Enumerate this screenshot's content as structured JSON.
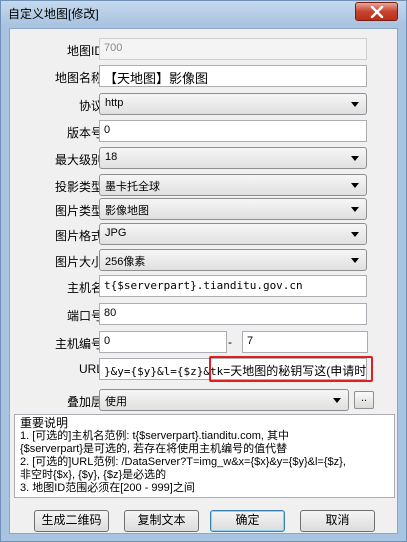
{
  "window": {
    "title": "自定义地图[修改]"
  },
  "form": {
    "map_id": {
      "label": "地图ID",
      "value": "700"
    },
    "map_name": {
      "label": "地图名称",
      "value": "【天地图】影像图"
    },
    "protocol": {
      "label": "协议",
      "value": "http"
    },
    "version": {
      "label": "版本号",
      "value": "0"
    },
    "max_level": {
      "label": "最大级别",
      "value": "18"
    },
    "projection": {
      "label": "投影类型",
      "value": "墨卡托全球"
    },
    "image_type": {
      "label": "图片类型",
      "value": "影像地图"
    },
    "image_format": {
      "label": "图片格式",
      "value": "JPG"
    },
    "image_size": {
      "label": "图片大小",
      "value": "256像素"
    },
    "host": {
      "label": "主机名",
      "value": "t{$serverpart}.tianditu.gov.cn"
    },
    "port": {
      "label": "端口号",
      "value": "80"
    },
    "host_number": {
      "label": "主机编号",
      "from": "0",
      "separator": "-",
      "to": "7"
    },
    "url": {
      "label": "URL",
      "value_prefix": "}&y={$y}&l={$z}&tk",
      "value_highlight": "=天地图的秘钥写这(申请时设"
    },
    "overlay": {
      "label": "叠加层",
      "value": "使用",
      "button": ".."
    }
  },
  "notes": {
    "heading": "重要说明",
    "lines": [
      "1. [可选的]主机名范例: t{$serverpart}.tianditu.com, 其中",
      "{$serverpart}是可选的, 若存在将使用主机编号的值代替",
      "2. [可选的]URL范例: /DataServer?T=img_w&x={$x}&y={$y}&l={$z},",
      "非空时{$x}, {$y}, {$z}是必选的",
      "3. 地图ID范围必须在[200 - 999]之间"
    ]
  },
  "buttons": {
    "qrcode": "生成二维码",
    "copy": "复制文本",
    "ok": "确定",
    "cancel": "取消"
  },
  "colors": {
    "highlight_border": "#e02020",
    "titlebar": "#a9c3df",
    "close_button": "#c7432d"
  }
}
